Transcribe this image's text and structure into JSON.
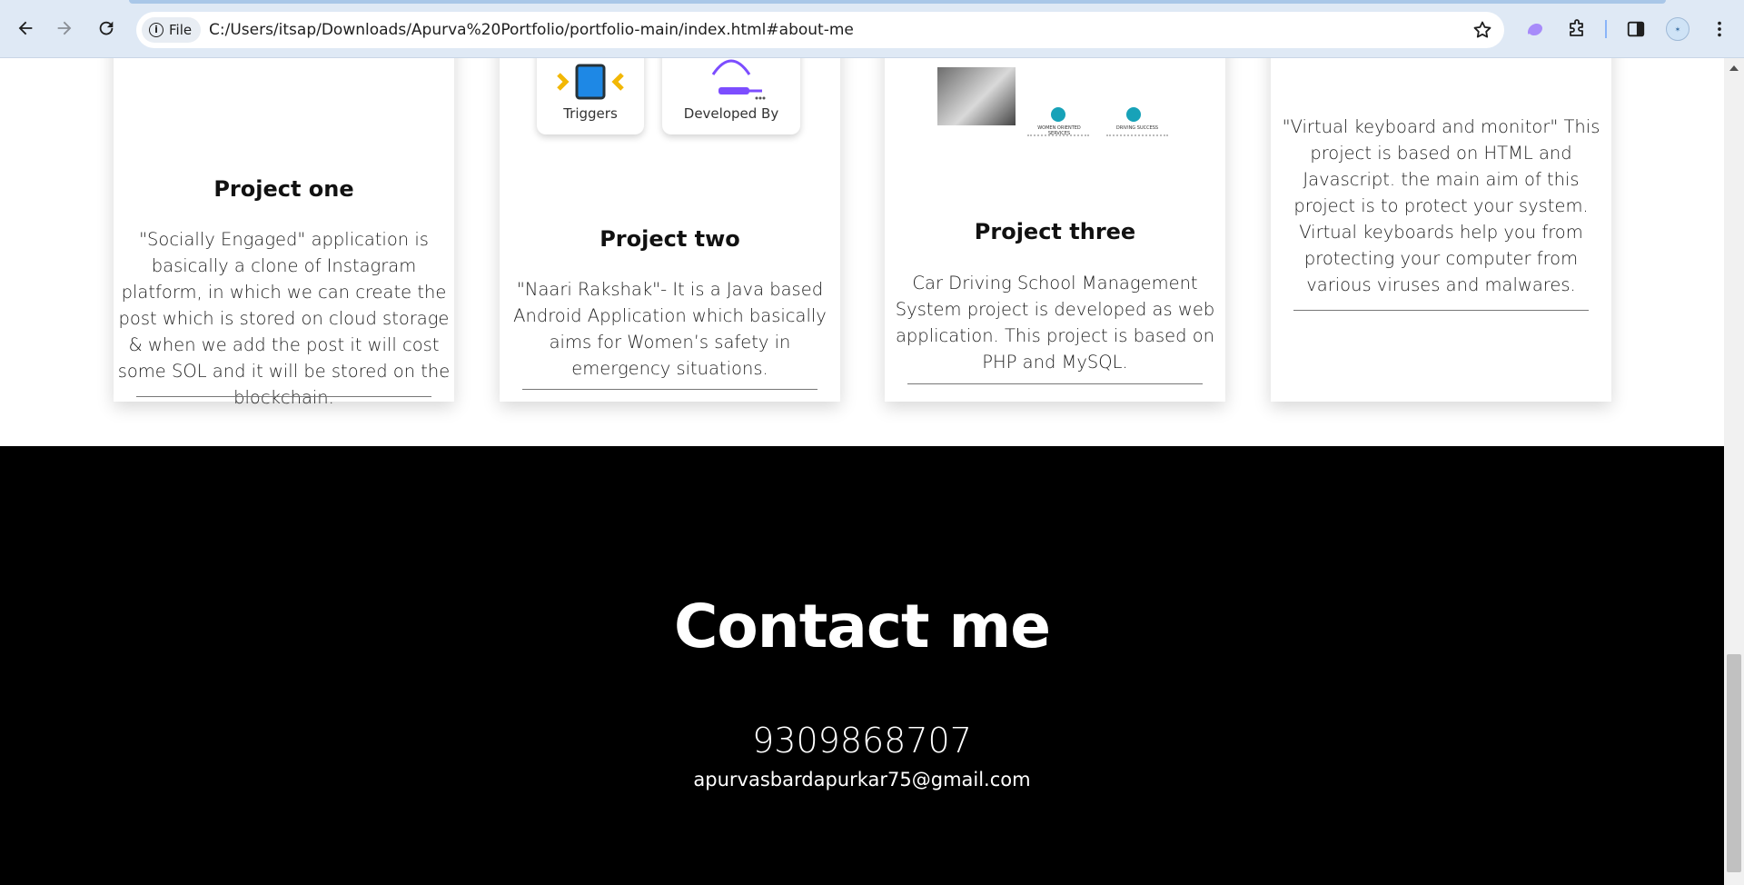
{
  "browser": {
    "file_chip": "File",
    "url": "C:/Users/itsap/Downloads/Apurva%20Portfolio/portfolio-main/index.html#about-me",
    "icons": [
      "back-icon",
      "forward-icon",
      "reload-icon",
      "info-icon",
      "star-icon",
      "extension-puzzle-icon",
      "side-panel-icon",
      "profile-avatar",
      "menu-kebab-icon"
    ]
  },
  "projects": [
    {
      "title": "Project one",
      "description": "\"Socially Engaged\" application is basically a clone of Instagram platform, in which we can create the post which is stored on cloud storage & when we add the post it will cost some SOL and it will be stored on the blockchain."
    },
    {
      "title": "Project two",
      "description": "\"Naari Rakshak\"- It is a Java based Android Application which basically aims for Women’s safety in emergency situations.",
      "image_captions": [
        "Triggers",
        "Developed By"
      ]
    },
    {
      "title": "Project three",
      "description": "Car Driving School Management System project is developed as web application. This project is based on PHP and MySQL.",
      "image_labels": [
        "WOMEN ORIENTED SERVICES",
        "DRIVING SUCCESS"
      ]
    },
    {
      "title": "",
      "description": "\"Virtual keyboard and monitor\" This project is based on HTML and Javascript. the main aim of this project is to protect your system. Virtual keyboards help you from protecting your computer from various viruses and malwares."
    }
  ],
  "contact": {
    "heading": "Contact me",
    "phone": "9309868707",
    "email": "apurvasbardapurkar75@gmail.com"
  },
  "colors": {
    "footer_bg": "#000000",
    "footer_text": "#ffffff",
    "chrome_bg": "#dfe9f5"
  }
}
